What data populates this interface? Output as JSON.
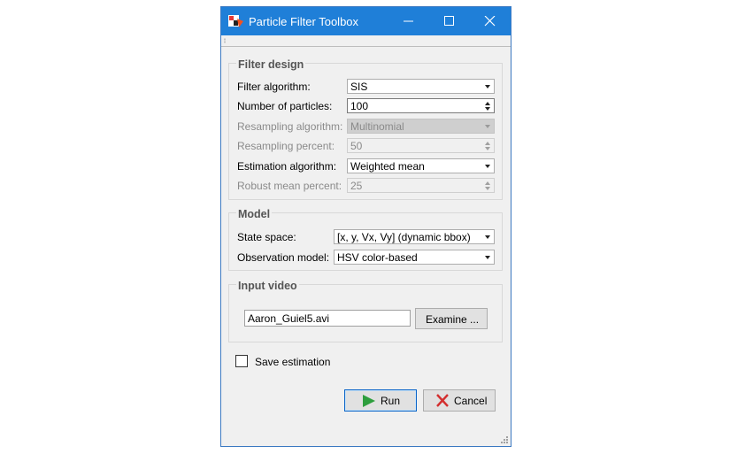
{
  "window": {
    "title": "Particle Filter Toolbox",
    "icon": "app-logo-icon"
  },
  "filter_design": {
    "title": "Filter design",
    "filter_algorithm": {
      "label": "Filter algorithm:",
      "value": "SIS"
    },
    "num_particles": {
      "label": "Number of particles:",
      "value": "100"
    },
    "resampling_algorithm": {
      "label": "Resampling algorithm:",
      "value": "Multinomial"
    },
    "resampling_percent": {
      "label": "Resampling percent:",
      "value": "50"
    },
    "estimation_algorithm": {
      "label": "Estimation algorithm:",
      "value": "Weighted mean"
    },
    "robust_mean_percent": {
      "label": "Robust mean percent:",
      "value": "25"
    }
  },
  "model": {
    "title": "Model",
    "state_space": {
      "label": "State space:",
      "value": "[x, y, Vx, Vy] (dynamic bbox)"
    },
    "observation_model": {
      "label": "Observation model:",
      "value": "HSV color-based"
    }
  },
  "input_video": {
    "title": "Input video",
    "file": "Aaron_Guiel5.avi",
    "examine_label": "Examine ..."
  },
  "save_estimation": {
    "label": "Save estimation",
    "checked": false
  },
  "buttons": {
    "run": "Run",
    "cancel": "Cancel"
  },
  "colors": {
    "titlebar": "#1f7fd8",
    "run_icon": "#2e9e3e",
    "cancel_icon": "#d32f2f"
  }
}
